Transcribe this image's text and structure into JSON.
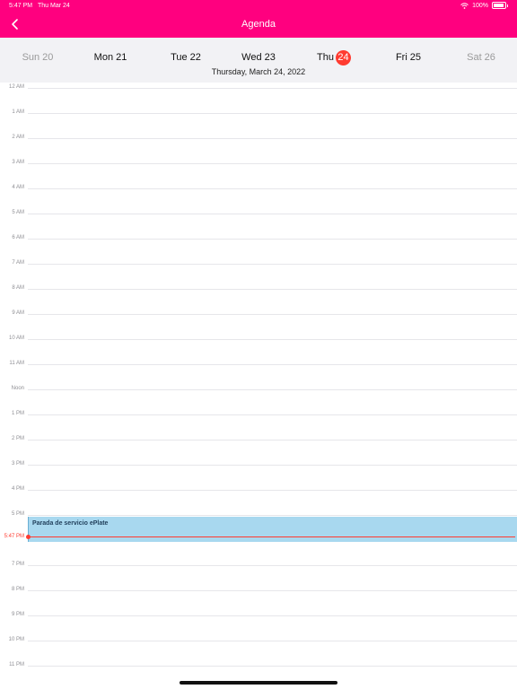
{
  "status_bar": {
    "time": "5:47 PM",
    "date": "Thu Mar 24",
    "battery": "100%"
  },
  "header": {
    "title": "Agenda"
  },
  "week": {
    "days": [
      {
        "name": "Sun",
        "num": "20"
      },
      {
        "name": "Mon",
        "num": "21"
      },
      {
        "name": "Tue",
        "num": "22"
      },
      {
        "name": "Wed",
        "num": "23"
      },
      {
        "name": "Thu",
        "num": "24"
      },
      {
        "name": "Fri",
        "num": "25"
      },
      {
        "name": "Sat",
        "num": "26"
      }
    ],
    "selected_date": "Thursday, March 24, 2022"
  },
  "hours": [
    "12 AM",
    "1 AM",
    "2 AM",
    "3 AM",
    "4 AM",
    "5 AM",
    "6 AM",
    "7 AM",
    "8 AM",
    "9 AM",
    "10 AM",
    "11 AM",
    "Noon",
    "1 PM",
    "2 PM",
    "3 PM",
    "4 PM",
    "5 PM",
    "",
    "7 PM",
    "8 PM",
    "9 PM",
    "10 PM",
    "11 PM"
  ],
  "event": {
    "title": "Parada de servicio ePlate"
  },
  "now": {
    "label": "5:47 PM"
  },
  "colors": {
    "header": "#ff007f",
    "today": "#ff3b30",
    "event_bg": "#a8d8ef"
  }
}
